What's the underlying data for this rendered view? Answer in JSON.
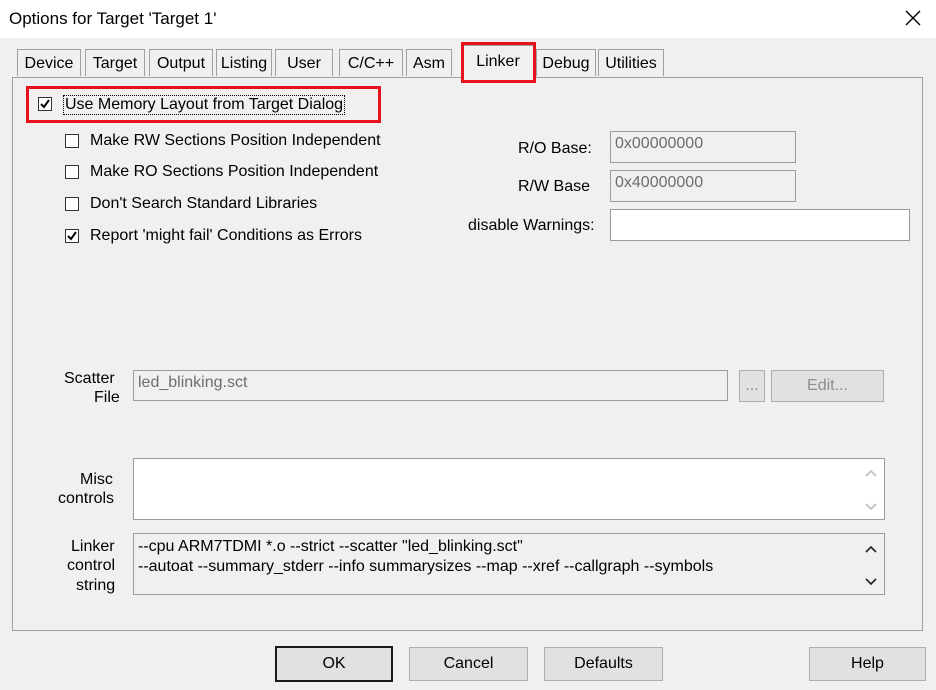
{
  "window": {
    "title": "Options for Target 'Target 1'"
  },
  "tabs": [
    {
      "label": "Device"
    },
    {
      "label": "Target"
    },
    {
      "label": "Output"
    },
    {
      "label": "Listing"
    },
    {
      "label": "User"
    },
    {
      "label": "C/C++"
    },
    {
      "label": "Asm"
    },
    {
      "label": "Linker"
    },
    {
      "label": "Debug"
    },
    {
      "label": "Utilities"
    }
  ],
  "active_tab": "Linker",
  "options": {
    "use_memory_layout": {
      "label": "Use Memory Layout from Target Dialog",
      "checked": true
    },
    "rw_position_independent": {
      "label": "Make RW Sections Position Independent",
      "checked": false
    },
    "ro_position_independent": {
      "label": "Make RO Sections Position Independent",
      "checked": false
    },
    "dont_search_std_libs": {
      "label": "Don't Search Standard Libraries",
      "checked": false
    },
    "report_might_fail": {
      "label": "Report 'might fail' Conditions as Errors",
      "checked": true
    }
  },
  "fields": {
    "ro_base": {
      "label": "R/O Base:",
      "value": "0x00000000"
    },
    "rw_base": {
      "label": "R/W Base",
      "value": "0x40000000"
    },
    "disable_warnings": {
      "label": "disable Warnings:",
      "value": ""
    }
  },
  "scatter": {
    "label_line1": "Scatter",
    "label_line2": "File",
    "value": "led_blinking.sct",
    "browse_label": "...",
    "edit_label": "Edit..."
  },
  "misc": {
    "label_line1": "Misc",
    "label_line2": "controls",
    "value": ""
  },
  "linker_control": {
    "label_line1": "Linker",
    "label_line2": "control",
    "label_line3": "string",
    "line1": "--cpu ARM7TDMI *.o --strict --scatter \"led_blinking.sct\"",
    "line2": "--autoat --summary_stderr --info summarysizes --map --xref --callgraph --symbols"
  },
  "buttons": {
    "ok": "OK",
    "cancel": "Cancel",
    "defaults": "Defaults",
    "help": "Help"
  },
  "icons": {
    "close": "close-icon",
    "check": "checkmark-icon",
    "scroll_up": "chevron-up-icon",
    "scroll_down": "chevron-down-icon"
  },
  "colors": {
    "highlight": "#e8121f",
    "background": "#f0f0f0"
  }
}
